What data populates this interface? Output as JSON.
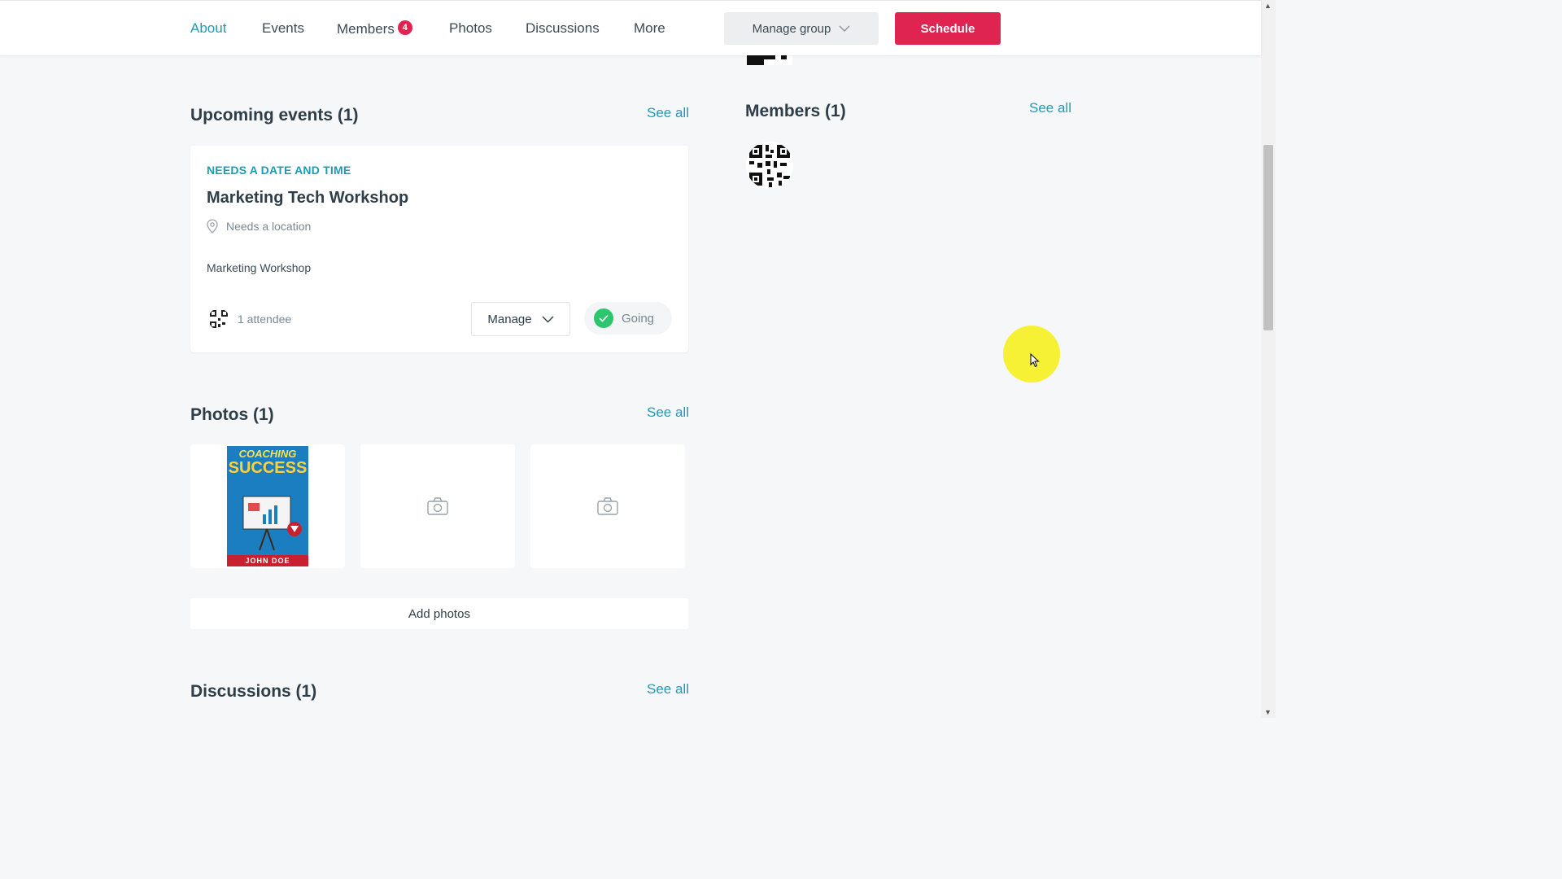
{
  "nav": {
    "tabs": [
      {
        "label": "About"
      },
      {
        "label": "Events"
      },
      {
        "label": "Members",
        "badge": "4"
      },
      {
        "label": "Photos"
      },
      {
        "label": "Discussions"
      },
      {
        "label": "More"
      }
    ],
    "manage_group_label": "Manage group",
    "schedule_label": "Schedule"
  },
  "upcoming": {
    "title": "Upcoming events (1)",
    "see_all": "See all",
    "event": {
      "status": "NEEDS A DATE AND TIME",
      "title": "Marketing Tech Workshop",
      "location": "Needs a location",
      "description": "Marketing Workshop",
      "attendees": "1 attendee",
      "manage_label": "Manage",
      "rsvp_label": "Going"
    }
  },
  "photos": {
    "title": "Photos (1)",
    "see_all": "See all",
    "book": {
      "line1": "COACHING",
      "line2": "SUCCESS",
      "author": "JOHN DOE"
    },
    "add_label": "Add photos"
  },
  "discussions": {
    "title": "Discussions (1)",
    "see_all": "See all"
  },
  "members": {
    "title": "Members (1)",
    "see_all": "See all"
  },
  "colors": {
    "accent": "#1e9bb5",
    "brand": "#e02452",
    "success": "#2dc66e"
  },
  "icons": [
    "chevron-down-icon",
    "location-pin-icon",
    "check-icon",
    "camera-icon",
    "qr-avatar-icon",
    "cursor-icon"
  ]
}
